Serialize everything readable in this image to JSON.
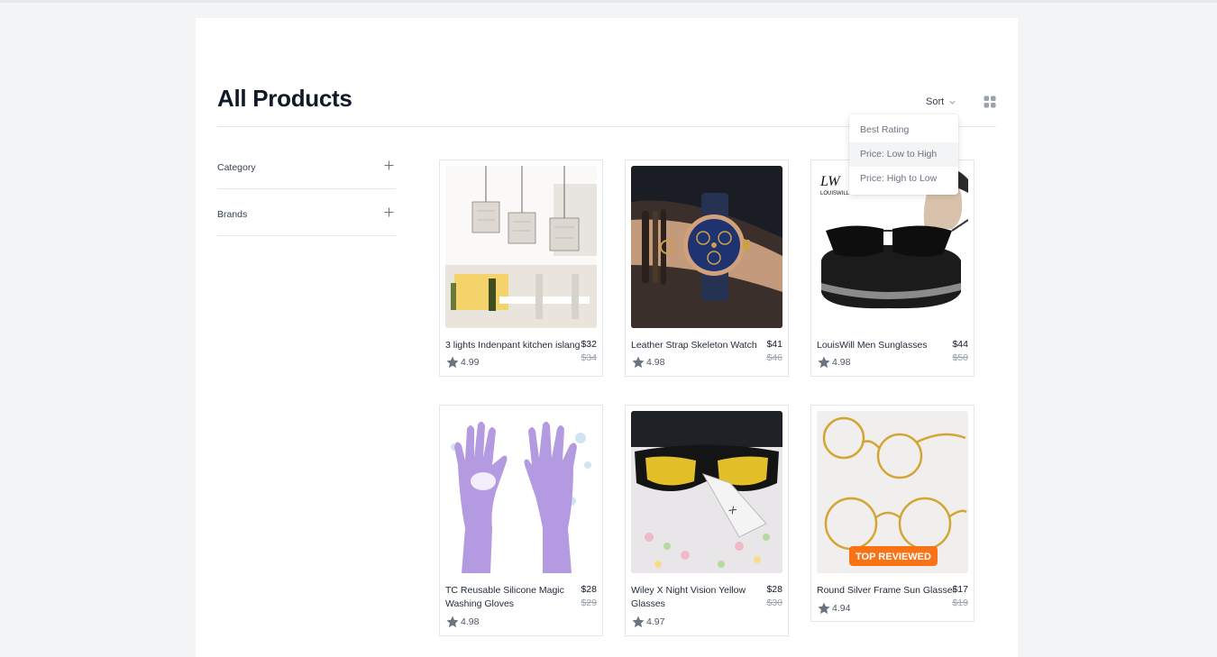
{
  "page": {
    "title": "All Products",
    "sort_label": "Sort",
    "sort_options": [
      "Best Rating",
      "Price: Low to High",
      "Price: High to Low"
    ]
  },
  "filters": [
    {
      "label": "Category"
    },
    {
      "label": "Brands"
    }
  ],
  "products": [
    {
      "name": "3 lights Indenpant kitchen islang",
      "price": "$32",
      "old_price": "$34",
      "rating": "4.99",
      "image": "pendant-lights"
    },
    {
      "name": "Leather Strap Skeleton Watch",
      "price": "$41",
      "old_price": "$46",
      "rating": "4.98",
      "image": "wrist-watch"
    },
    {
      "name": "LouisWill Men Sunglasses",
      "price": "$44",
      "old_price": "$50",
      "rating": "4.98",
      "image": "sunglasses",
      "image_text": "LOUISWILL"
    },
    {
      "name": "TC Reusable Silicone Magic Washing Gloves",
      "price": "$28",
      "old_price": "$29",
      "rating": "4.98",
      "image": "purple-gloves"
    },
    {
      "name": "Wiley X Night Vision Yellow Glasses",
      "price": "$28",
      "old_price": "$30",
      "rating": "4.97",
      "image": "yellow-glasses"
    },
    {
      "name": "Round Silver Frame Sun Glasses",
      "price": "$17",
      "old_price": "$19",
      "rating": "4.94",
      "image": "round-glasses",
      "badge": "TOP REVIEWED"
    }
  ],
  "colors": {
    "star": "#6b7280",
    "badge": "#f97316",
    "background": "#f3f4f6"
  }
}
